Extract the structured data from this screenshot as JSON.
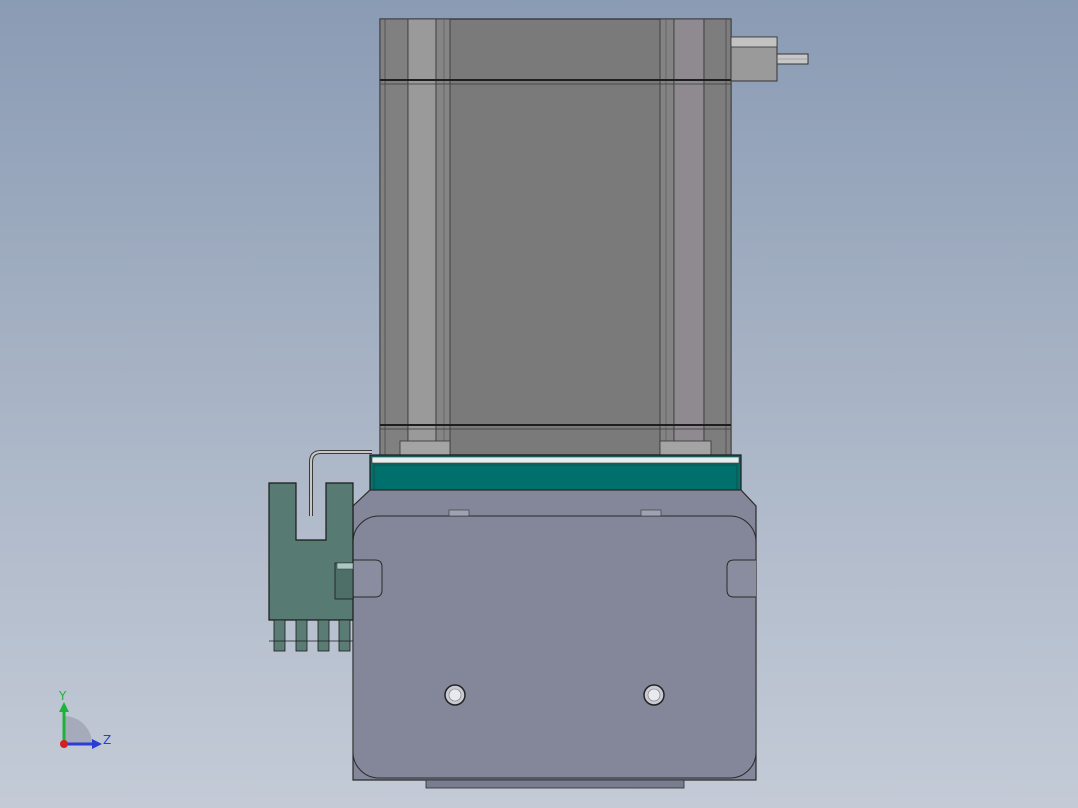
{
  "view": {
    "background_top": "#8a9bb4",
    "background_bottom": "#c4cbd7"
  },
  "model": {
    "motor_body_color": "#7a7a7a",
    "motor_edge_color": "#8f8f8f",
    "flange_color": "#007672",
    "base_plate_color": "#848699",
    "connector_color": "#577a72",
    "shaft_color": "#c7c7c7"
  },
  "triad": {
    "y_label": "Y",
    "z_label": "Z",
    "y_color": "#1fb23a",
    "z_color": "#2a3ed6",
    "x_color": "#d42020"
  }
}
